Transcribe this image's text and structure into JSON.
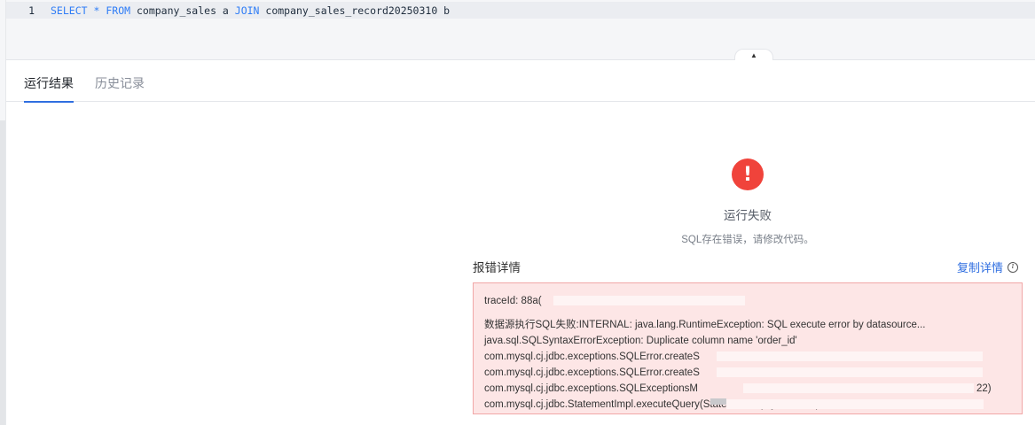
{
  "editor": {
    "line_number": "1",
    "sql_tokens": [
      {
        "t": "SELECT",
        "k": "kw"
      },
      {
        "t": " ",
        "k": "sp"
      },
      {
        "t": "*",
        "k": "op"
      },
      {
        "t": " ",
        "k": "sp"
      },
      {
        "t": "FROM",
        "k": "kw"
      },
      {
        "t": " company_sales a ",
        "k": "id"
      },
      {
        "t": "JOIN",
        "k": "kw"
      },
      {
        "t": " company_sales_record20250310 b",
        "k": "id"
      }
    ],
    "collapse_icon": "▲"
  },
  "tabs": [
    {
      "label": "运行结果",
      "active": true
    },
    {
      "label": "历史记录",
      "active": false
    }
  ],
  "result": {
    "status_icon": "!",
    "title": "运行失败",
    "subtitle": "SQL存在错误，请修改代码。",
    "detail_label": "报错详情",
    "copy_label": "复制详情",
    "info_icon": "i",
    "trace_id": "traceId: 88a(",
    "lines": [
      "数据源执行SQL失败:INTERNAL: java.lang.RuntimeException: SQL execute error by datasource...",
      "java.sql.SQLSyntaxErrorException: Duplicate column name 'order_id'",
      "com.mysql.cj.jdbc.exceptions.SQLError.createS",
      "com.mysql.cj.jdbc.exceptions.SQLError.createS",
      "com.mysql.cj.jdbc.exceptions.SQLExceptionsM",
      "com.mysql.cj.jdbc.StatementImpl.executeQuery(StatementImpl.java:1200)"
    ],
    "line5_suffix": "22)"
  },
  "colors": {
    "accent": "#2f6ee0",
    "error": "#f0433b",
    "error_bg": "#fde6e6",
    "error_border": "#f1a7a7"
  }
}
